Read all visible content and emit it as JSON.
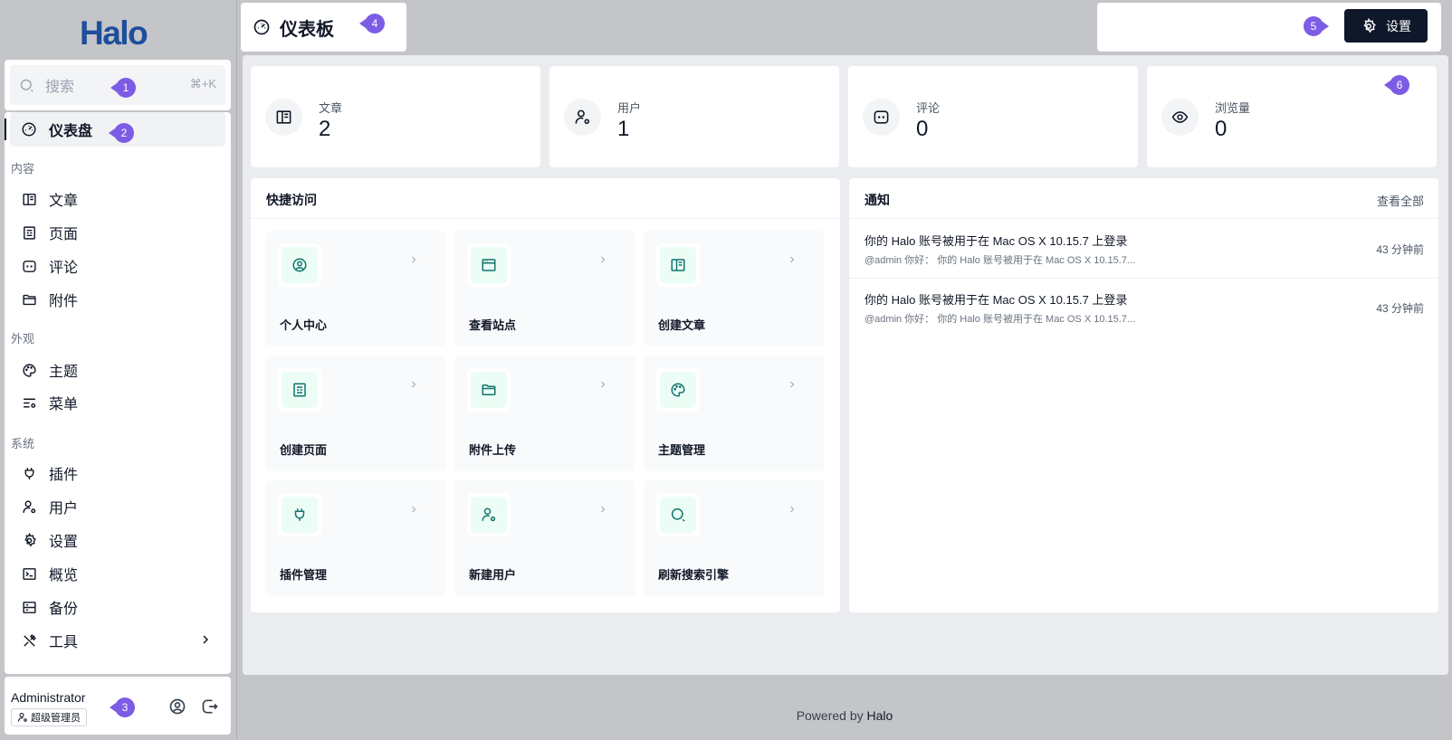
{
  "brand": {
    "logo_text": "Halo",
    "logo_color": "#1e4e9c"
  },
  "search": {
    "placeholder": "搜索",
    "shortcut": "⌘+K"
  },
  "sidebar": {
    "active": "仪表盘",
    "dashboard_label": "仪表盘",
    "groups": {
      "content": "内容",
      "appearance": "外观",
      "system": "系统"
    },
    "items": {
      "posts": "文章",
      "pages": "页面",
      "comments": "评论",
      "attachments": "附件",
      "themes": "主题",
      "menus": "菜单",
      "plugins": "插件",
      "users": "用户",
      "settings": "设置",
      "overview": "概览",
      "backup": "备份",
      "tools": "工具"
    }
  },
  "user": {
    "name": "Administrator",
    "role": "超级管理员"
  },
  "header": {
    "title": "仪表板",
    "settings_label": "设置"
  },
  "stats": [
    {
      "label": "文章",
      "value": "2",
      "icon": "book-icon"
    },
    {
      "label": "用户",
      "value": "1",
      "icon": "user-cog-icon"
    },
    {
      "label": "评论",
      "value": "0",
      "icon": "comment-icon"
    },
    {
      "label": "浏览量",
      "value": "0",
      "icon": "eye-icon"
    }
  ],
  "quick_access": {
    "title": "快捷访问",
    "items": [
      {
        "label": "个人中心",
        "icon": "user-circle-icon"
      },
      {
        "label": "查看站点",
        "icon": "browser-icon"
      },
      {
        "label": "创建文章",
        "icon": "book-icon"
      },
      {
        "label": "创建页面",
        "icon": "page-icon"
      },
      {
        "label": "附件上传",
        "icon": "folder-icon"
      },
      {
        "label": "主题管理",
        "icon": "palette-icon"
      },
      {
        "label": "插件管理",
        "icon": "plug-icon"
      },
      {
        "label": "新建用户",
        "icon": "user-cog-icon"
      },
      {
        "label": "刷新搜索引擎",
        "icon": "search-icon"
      }
    ]
  },
  "notifications": {
    "title": "通知",
    "view_all": "查看全部",
    "items": [
      {
        "title": "你的 Halo 账号被用于在 Mac OS X 10.15.7 上登录",
        "desc": "@admin 你好： 你的 Halo 账号被用于在 Mac OS X 10.15.7...",
        "time": "43 分钟前"
      },
      {
        "title": "你的 Halo 账号被用于在 Mac OS X 10.15.7 上登录",
        "desc": "@admin 你好： 你的 Halo 账号被用于在 Mac OS X 10.15.7...",
        "time": "43 分钟前"
      }
    ]
  },
  "footer": {
    "prefix": "Powered by",
    "brand": "Halo"
  },
  "tour_markers": [
    "1",
    "2",
    "3",
    "4",
    "5",
    "6"
  ],
  "colors": {
    "accent": "#7c5ce5",
    "dark_button": "#0f172a",
    "quick_icon": "#0f766e",
    "quick_icon_bg": "#ecfdf5"
  }
}
